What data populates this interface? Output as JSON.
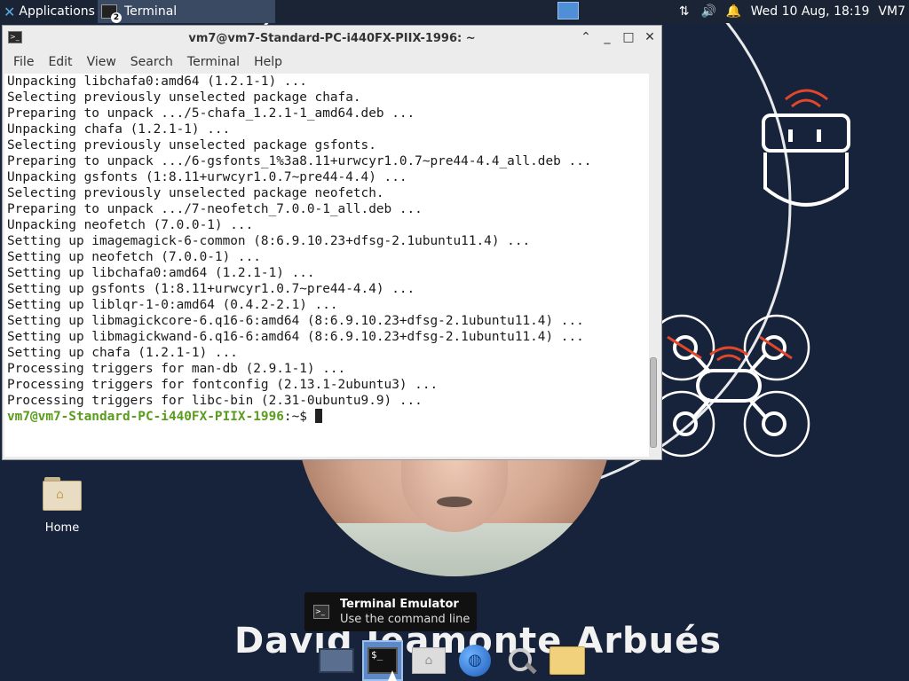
{
  "top_panel": {
    "applications_label": "Applications",
    "applications_menu_symbol": "≡",
    "task_label": "Terminal",
    "task_badge": "2",
    "clock": "Wed 10 Aug, 18:19",
    "user": "VM7"
  },
  "terminal": {
    "title": "vm7@vm7-Standard-PC-i440FX-PIIX-1996: ~",
    "window_icon_text": ">_",
    "controls": {
      "shade": "⌃",
      "minimize": "_",
      "maximize": "□",
      "close": "✕"
    },
    "menu": [
      "File",
      "Edit",
      "View",
      "Search",
      "Terminal",
      "Help"
    ],
    "lines": [
      "Unpacking libchafa0:amd64 (1.2.1-1) ...",
      "Selecting previously unselected package chafa.",
      "Preparing to unpack .../5-chafa_1.2.1-1_amd64.deb ...",
      "Unpacking chafa (1.2.1-1) ...",
      "Selecting previously unselected package gsfonts.",
      "Preparing to unpack .../6-gsfonts_1%3a8.11+urwcyr1.0.7~pre44-4.4_all.deb ...",
      "Unpacking gsfonts (1:8.11+urwcyr1.0.7~pre44-4.4) ...",
      "Selecting previously unselected package neofetch.",
      "Preparing to unpack .../7-neofetch_7.0.0-1_all.deb ...",
      "Unpacking neofetch (7.0.0-1) ...",
      "Setting up imagemagick-6-common (8:6.9.10.23+dfsg-2.1ubuntu11.4) ...",
      "Setting up neofetch (7.0.0-1) ...",
      "Setting up libchafa0:amd64 (1.2.1-1) ...",
      "Setting up gsfonts (1:8.11+urwcyr1.0.7~pre44-4.4) ...",
      "Setting up liblqr-1-0:amd64 (0.4.2-2.1) ...",
      "Setting up libmagickcore-6.q16-6:amd64 (8:6.9.10.23+dfsg-2.1ubuntu11.4) ...",
      "Setting up libmagickwand-6.q16-6:amd64 (8:6.9.10.23+dfsg-2.1ubuntu11.4) ...",
      "Setting up chafa (1.2.1-1) ...",
      "Processing triggers for man-db (2.9.1-1) ...",
      "Processing triggers for fontconfig (2.13.1-2ubuntu3) ...",
      "Processing triggers for libc-bin (2.31-0ubuntu9.9) ..."
    ],
    "prompt_user": "vm7@vm7-Standard-PC-i440FX-PIIX-1996",
    "prompt_suffix": ":~$ "
  },
  "desktop": {
    "home_icon_label": "Home",
    "wallpaper_name": "David Jeamonte Arbués"
  },
  "tooltip": {
    "title": "Terminal Emulator",
    "subtitle": "Use the command line"
  },
  "dock": {
    "items": [
      "show-desktop-icon",
      "terminal-icon",
      "home-folder-icon",
      "web-browser-icon",
      "app-finder-icon",
      "file-manager-icon"
    ],
    "terminal_glyph": "$_"
  },
  "colors": {
    "panel_bg": "#1b2434",
    "desktop_bg": "#17233a",
    "prompt_green": "#5a9c1c",
    "active_task": "#3a4a63",
    "dock_active": "#5d89c7"
  }
}
